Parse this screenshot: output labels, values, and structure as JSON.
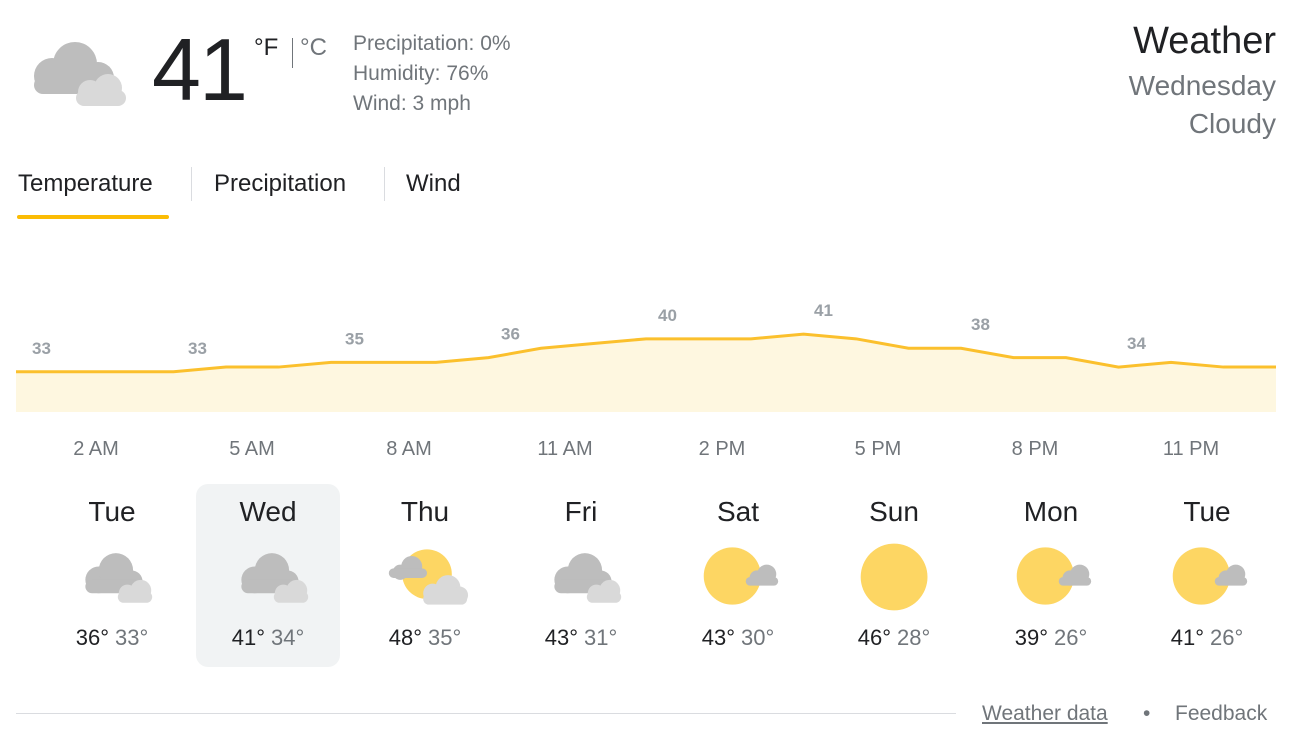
{
  "current": {
    "icon": "cloudy-icon",
    "temperature": "41",
    "unit_f": "°F",
    "unit_c": "°C",
    "precipitation": "Precipitation: 0%",
    "humidity": "Humidity: 76%",
    "wind": "Wind: 3 mph"
  },
  "header": {
    "title": "Weather",
    "day": "Wednesday",
    "condition": "Cloudy"
  },
  "tabs": [
    {
      "label": "Temperature",
      "selected": true
    },
    {
      "label": "Precipitation",
      "selected": false
    },
    {
      "label": "Wind",
      "selected": false
    }
  ],
  "colors": {
    "accent": "#fbbc04",
    "chart_fill": "#fef7e0",
    "chart_line": "#fbc02d",
    "label_gray": "#9aa0a6"
  },
  "hourly": {
    "labeled_points": [
      {
        "time": "2 AM",
        "temp": 33
      },
      {
        "time": "5 AM",
        "temp": 33
      },
      {
        "time": "8 AM",
        "temp": 35
      },
      {
        "time": "11 AM",
        "temp": 36
      },
      {
        "time": "2 PM",
        "temp": 40
      },
      {
        "time": "5 PM",
        "temp": 41
      },
      {
        "time": "8 PM",
        "temp": 38
      },
      {
        "time": "11 PM",
        "temp": 34
      }
    ],
    "series": [
      33,
      33,
      33,
      33,
      34,
      34,
      35,
      35,
      35,
      36,
      38,
      39,
      40,
      40,
      40,
      41,
      40,
      38,
      38,
      36,
      36,
      34,
      35,
      34,
      34
    ]
  },
  "daily": [
    {
      "day": "Tue",
      "icon": "cloudy-icon",
      "high": "36°",
      "low": "33°",
      "selected": false
    },
    {
      "day": "Wed",
      "icon": "cloudy-icon",
      "high": "41°",
      "low": "34°",
      "selected": true
    },
    {
      "day": "Thu",
      "icon": "partly-cloudy-icon",
      "high": "48°",
      "low": "35°",
      "selected": false
    },
    {
      "day": "Fri",
      "icon": "cloudy-icon",
      "high": "43°",
      "low": "31°",
      "selected": false
    },
    {
      "day": "Sat",
      "icon": "mostly-sunny-icon",
      "high": "43°",
      "low": "30°",
      "selected": false
    },
    {
      "day": "Sun",
      "icon": "sunny-icon",
      "high": "46°",
      "low": "28°",
      "selected": false
    },
    {
      "day": "Mon",
      "icon": "mostly-sunny-icon",
      "high": "39°",
      "low": "26°",
      "selected": false
    },
    {
      "day": "Tue",
      "icon": "mostly-sunny-icon",
      "high": "41°",
      "low": "26°",
      "selected": false
    }
  ],
  "footer": {
    "data_link": "Weather data",
    "separator": "•",
    "feedback_link": "Feedback"
  }
}
